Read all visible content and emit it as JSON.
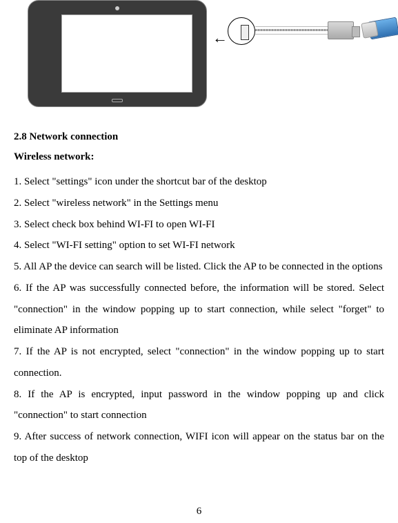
{
  "section_heading": "2.8 Network connection",
  "sub_heading": "Wireless network:",
  "steps": {
    "s1": "1. Select \"settings\" icon under the shortcut bar of the desktop",
    "s2": "2. Select \"wireless network\" in the Settings menu",
    "s3": "3. Select check box behind WI-FI to open WI-FI",
    "s4": "4. Select \"WI-FI setting\" option to set WI-FI network",
    "s5": "5. All AP the device can search will be listed. Click the AP to be connected in the options",
    "s6": "6. If the AP was successfully connected before, the information will be stored. Select \"connection\" in the window popping up to start connection, while select \"forget\" to eliminate AP information",
    "s7": "7. If the AP is not encrypted, select \"connection\" in the window popping up to start connection.",
    "s8": "8. If the AP is encrypted, input password in the window popping up and click \"connection\" to start connection",
    "s9": "9. After success of network connection, WIFI icon will appear on the status bar on the top of the desktop"
  },
  "page_number": "6"
}
